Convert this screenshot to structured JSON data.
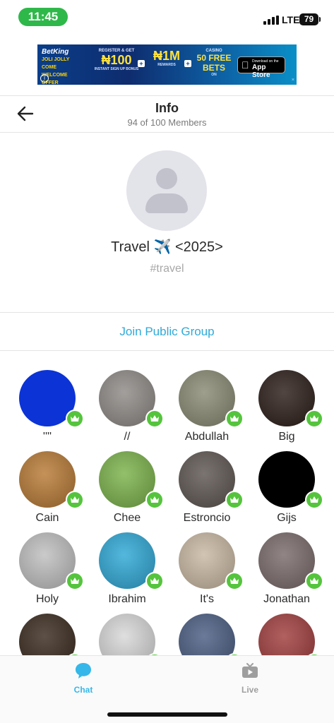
{
  "status_bar": {
    "time": "11:45",
    "network": "LTE",
    "battery": "79"
  },
  "ad": {
    "brand": "BetKing",
    "tagline": "JOLI JOLLY COME WELCOME OFFER",
    "blocks": [
      {
        "caption": "REGISTER & GET",
        "big": "₦100",
        "small": "INSTANT SIGN UP BONUS"
      },
      {
        "caption": "",
        "big": "₦1M",
        "small": "REWARDS"
      },
      {
        "caption": "CASINO",
        "big": "50 FREE BETS",
        "small": "ON"
      }
    ],
    "store_line1": "Download on the",
    "store_line2": "App Store"
  },
  "header": {
    "title": "Info",
    "subtitle": "94 of 100 Members"
  },
  "group": {
    "name": "Travel",
    "name_suffix": "<2025>",
    "emoji": "✈️",
    "tag": "#travel"
  },
  "join_label": "Join Public Group",
  "members": [
    {
      "name": "''''",
      "bg": "#0b33d6"
    },
    {
      "name": "//",
      "bg": "#8f8a86"
    },
    {
      "name": "Abdullah",
      "bg": "#8a8a74"
    },
    {
      "name": "Big",
      "bg": "#2b1d18"
    },
    {
      "name": "Cain",
      "bg": "#b87a35"
    },
    {
      "name": "Chee",
      "bg": "#7bb34a"
    },
    {
      "name": "Estroncio",
      "bg": "#5e5652"
    },
    {
      "name": "Gijs",
      "bg": "#000000"
    },
    {
      "name": "Holy",
      "bg": "#bfbfbf"
    },
    {
      "name": "Ibrahim",
      "bg": "#2ea8d6"
    },
    {
      "name": "It's",
      "bg": "#c9b8a2"
    },
    {
      "name": "Jonathan",
      "bg": "#7a6a6a"
    },
    {
      "name": "",
      "bg": "#3a2a1e"
    },
    {
      "name": "",
      "bg": "#d8d8d8"
    },
    {
      "name": "",
      "bg": "#4a5d82"
    },
    {
      "name": "",
      "bg": "#a13d3d"
    }
  ],
  "tabs": {
    "chat": "Chat",
    "live": "Live"
  },
  "colors": {
    "accent": "#35b7ea",
    "crown": "#55c43d",
    "time_pill": "#2fb84a"
  }
}
